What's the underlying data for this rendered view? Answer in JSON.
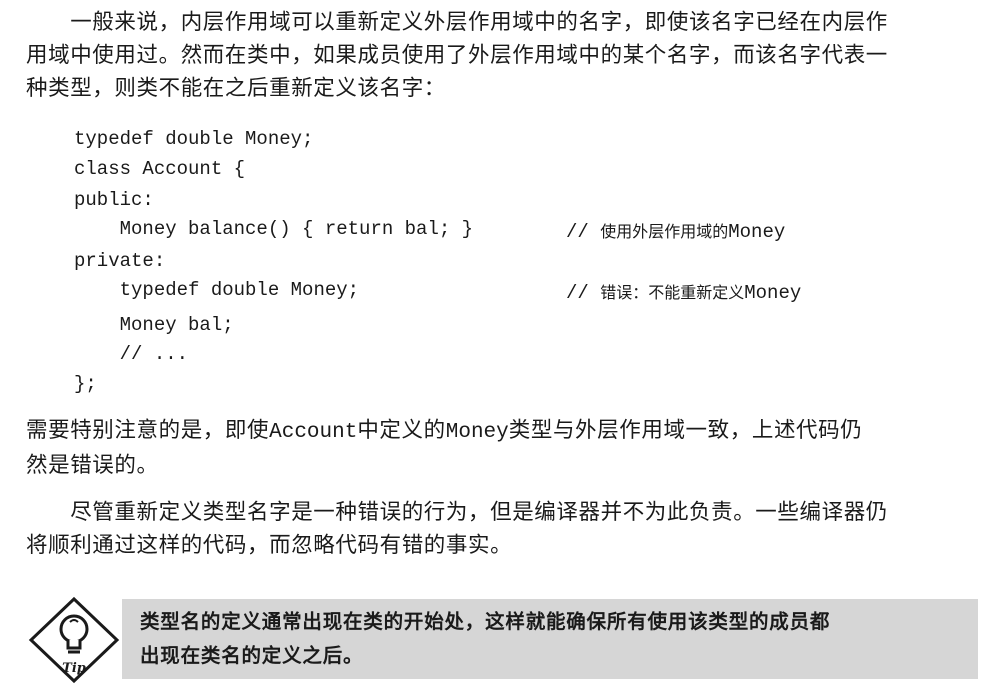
{
  "paragraph1": {
    "lines": [
      "　　一般来说，内层作用域可以重新定义外层作用域中的名字，即使该名字已经在内层作",
      "用域中使用过。然而在类中，如果成员使用了外层作用域中的某个名字，而该名字代表一",
      "种类型，则类不能在之后重新定义该名字："
    ]
  },
  "code": {
    "lines": [
      "typedef double Money;",
      "class Account {",
      "public:",
      "    Money balance() { return bal; }",
      "private:",
      "    typedef double Money;",
      "    Money bal;",
      "    // ...",
      "};"
    ],
    "comment1": {
      "prefix": "// ",
      "cjk": "使用外层作用域的",
      "mono": "Money"
    },
    "comment2": {
      "prefix": "// ",
      "cjk": "错误：不能重新定义",
      "mono": "Money"
    }
  },
  "paragraph2": {
    "line1_part1": "需要特别注意的是，即使",
    "line1_code1": "Account",
    "line1_part2": "中定义的",
    "line1_code2": "Money",
    "line1_part3": "类型与外层作用域一致，上述代码仍",
    "line2": "然是错误的。"
  },
  "paragraph3": {
    "lines": [
      "　　尽管重新定义类型名字是一种错误的行为，但是编译器并不为此负责。一些编译器仍",
      "将顺利通过这样的代码，而忽略代码有错的事实。"
    ]
  },
  "tip": {
    "icon_label": "Tip",
    "lines": [
      "类型名的定义通常出现在类的开始处，这样就能确保所有使用该类型的成员都",
      "出现在类名的定义之后。"
    ],
    "box_color": "#d6d6d6"
  }
}
